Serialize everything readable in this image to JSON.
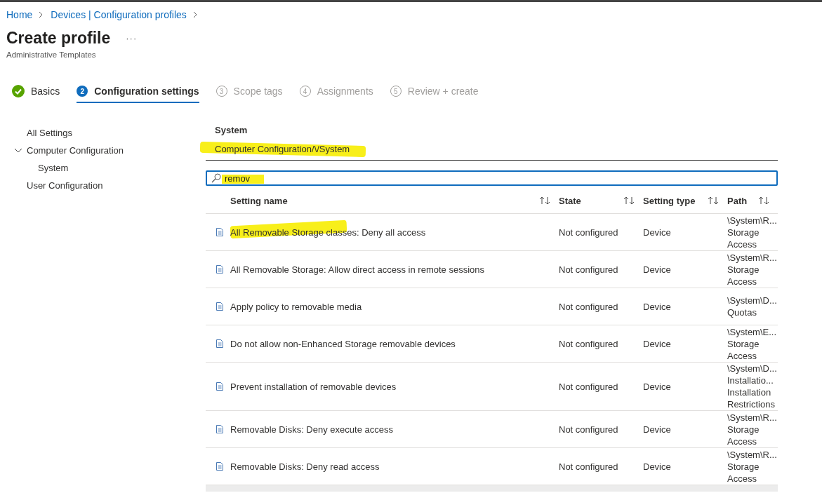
{
  "breadcrumb": [
    {
      "label": "Home"
    },
    {
      "label": "Devices | Configuration profiles"
    }
  ],
  "page": {
    "title": "Create profile",
    "more": "···",
    "subtitle": "Administrative Templates"
  },
  "steps": [
    {
      "label": "Basics",
      "kind": "done",
      "selected": false
    },
    {
      "number": "2",
      "label": "Configuration settings",
      "kind": "current",
      "selected": true
    },
    {
      "number": "3",
      "label": "Scope tags",
      "kind": "pending",
      "selected": false
    },
    {
      "number": "4",
      "label": "Assignments",
      "kind": "pending",
      "selected": false
    },
    {
      "number": "5",
      "label": "Review + create",
      "kind": "pending",
      "selected": false
    }
  ],
  "tree": [
    {
      "label": "All Settings"
    },
    {
      "label": "Computer Configuration",
      "expanded": true,
      "children": [
        {
          "label": "System"
        }
      ]
    },
    {
      "label": "User Configuration",
      "expanded": false
    }
  ],
  "section": {
    "title": "System",
    "path": "Computer Configuration/\\/System",
    "path_highlighted": true
  },
  "search": {
    "value": "remov",
    "highlighted": true
  },
  "table": {
    "columns": [
      {
        "label": "Setting name"
      },
      {
        "label": "State"
      },
      {
        "label": "Setting type"
      },
      {
        "label": "Path"
      }
    ],
    "rows": [
      {
        "name": "All Removable Storage classes: Deny all access",
        "highlighted": true,
        "state": "Not configured",
        "type": "Device",
        "path": "\\System\\R...\nStorage\nAccess"
      },
      {
        "name": "All Removable Storage: Allow direct access in remote sessions",
        "highlighted": false,
        "state": "Not configured",
        "type": "Device",
        "path": "\\System\\R...\nStorage\nAccess"
      },
      {
        "name": "Apply policy to removable media",
        "highlighted": false,
        "state": "Not configured",
        "type": "Device",
        "path": "\\System\\D...\nQuotas"
      },
      {
        "name": "Do not allow non-Enhanced Storage removable devices",
        "highlighted": false,
        "state": "Not configured",
        "type": "Device",
        "path": "\\System\\E...\nStorage\nAccess"
      },
      {
        "name": "Prevent installation of removable devices",
        "highlighted": false,
        "state": "Not configured",
        "type": "Device",
        "path": "\\System\\D...\nInstallatio...\nInstallation\nRestrictions"
      },
      {
        "name": "Removable Disks: Deny execute access",
        "highlighted": false,
        "state": "Not configured",
        "type": "Device",
        "path": "\\System\\R...\nStorage\nAccess"
      },
      {
        "name": "Removable Disks: Deny read access",
        "highlighted": false,
        "state": "Not configured",
        "type": "Device",
        "path": "\\System\\R...\nStorage\nAccess"
      }
    ]
  }
}
